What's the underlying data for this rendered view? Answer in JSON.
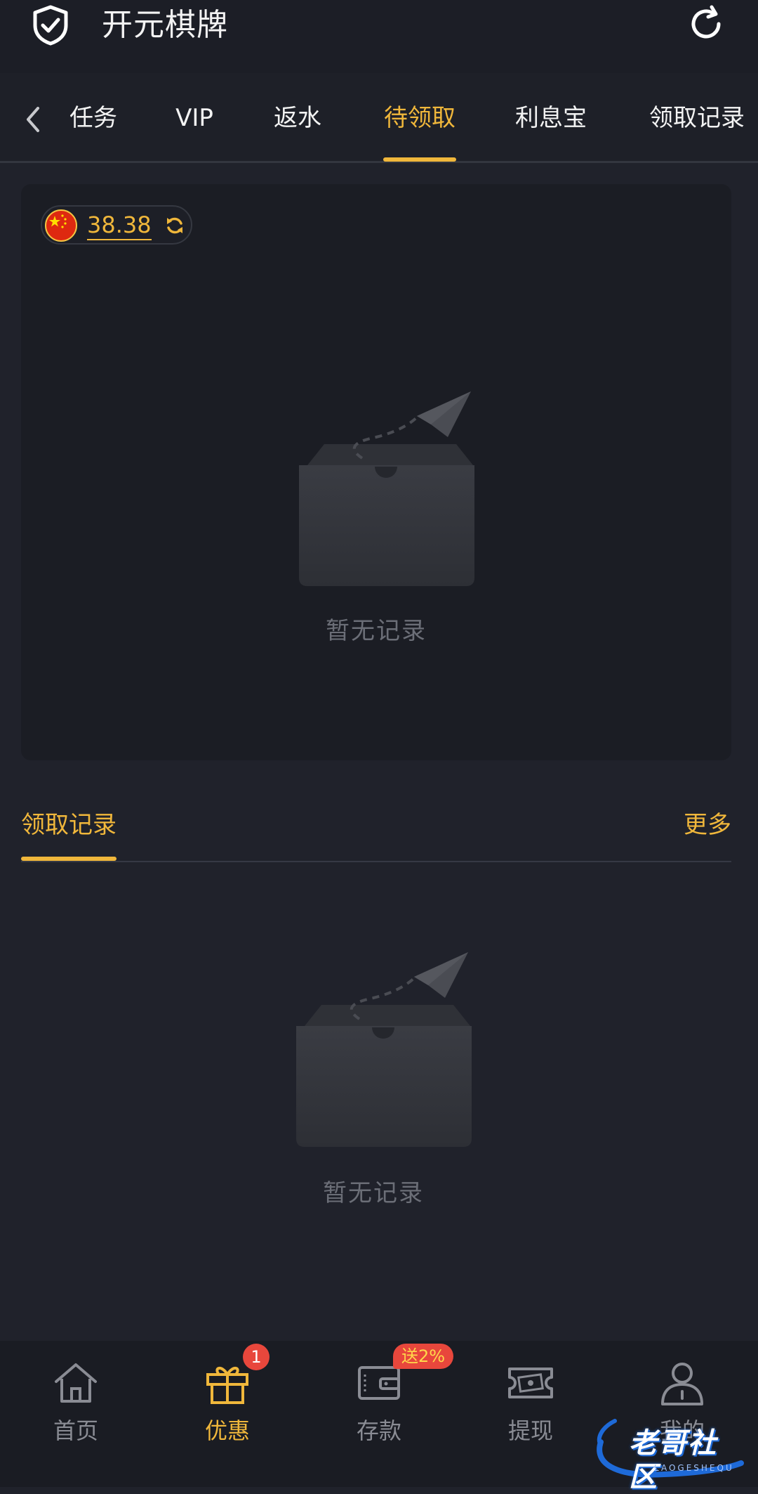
{
  "header": {
    "title": "开元棋牌",
    "left_icon": "shield-check-icon",
    "right_icon": "refresh-icon"
  },
  "tabs": {
    "items": [
      {
        "label": "任务"
      },
      {
        "label": "VIP"
      },
      {
        "label": "返水"
      },
      {
        "label": "待领取",
        "active": true
      },
      {
        "label": "利息宝"
      },
      {
        "label": "领取记录"
      }
    ]
  },
  "pending": {
    "currency_icon": "china-flag-icon",
    "balance": "38.38",
    "empty_text": "暂无记录"
  },
  "records": {
    "title": "领取记录",
    "more": "更多",
    "empty_text": "暂无记录"
  },
  "bottom_nav": {
    "items": [
      {
        "label": "首页",
        "icon": "home-icon"
      },
      {
        "label": "优惠",
        "icon": "gift-icon",
        "active": true,
        "badge": "1"
      },
      {
        "label": "存款",
        "icon": "wallet-icon",
        "badge": "送2%"
      },
      {
        "label": "提现",
        "icon": "cash-icon"
      },
      {
        "label": "我的",
        "icon": "user-icon"
      }
    ]
  },
  "watermark": {
    "text": "老哥社区",
    "sub": "LAOGESHEQU"
  },
  "colors": {
    "accent": "#f0b73b",
    "background": "#20222b",
    "badge": "#e8473c"
  }
}
